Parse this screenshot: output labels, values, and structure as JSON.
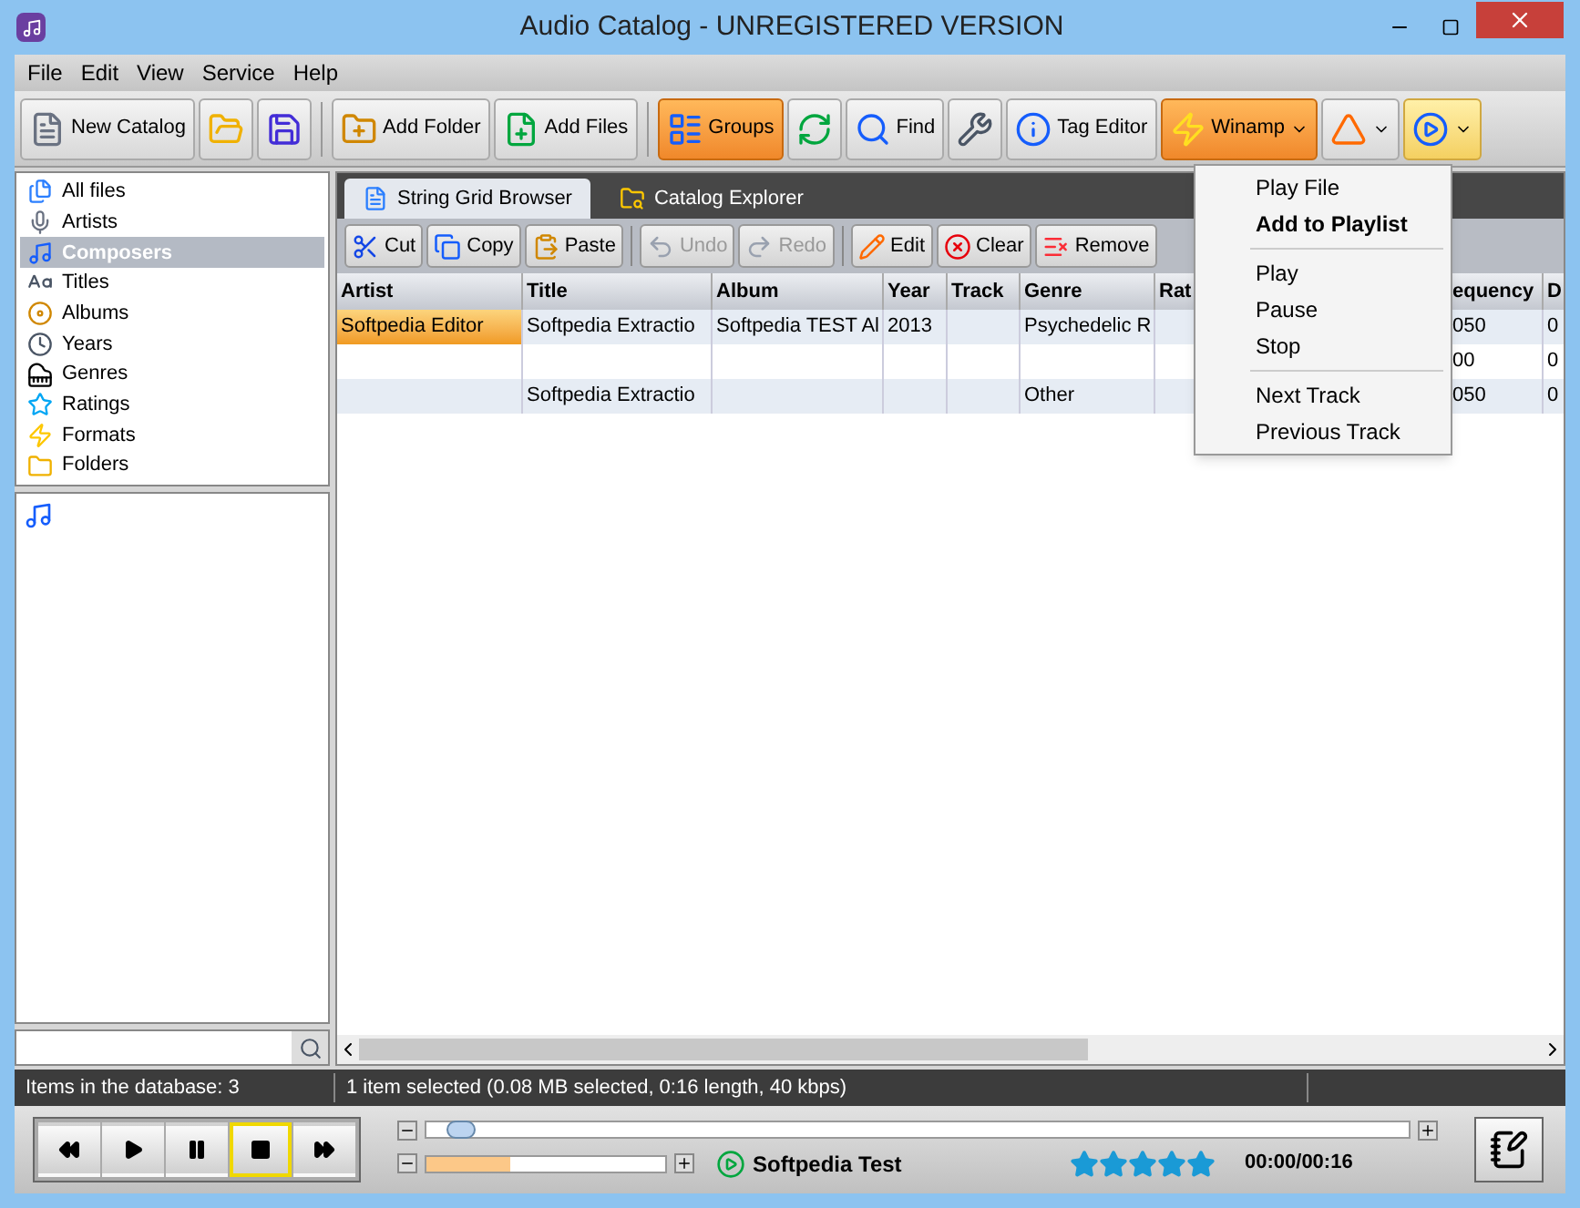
{
  "window": {
    "title": "Audio Catalog - UNREGISTERED VERSION"
  },
  "menu": [
    "File",
    "Edit",
    "View",
    "Service",
    "Help"
  ],
  "toolbar": [
    [
      {
        "label": "New Catalog",
        "selected": false
      },
      {
        "selected": false
      },
      {
        "selected": false
      }
    ],
    [
      {
        "label": "Add Folder",
        "selected": false
      },
      {
        "label": "Add Files",
        "selected": false
      }
    ],
    [
      {
        "label": "Groups",
        "selected": true
      },
      {
        "selected": false
      },
      {
        "label": "Find",
        "selected": false
      },
      {
        "selected": false
      },
      {
        "label": "Tag Editor",
        "selected": false
      },
      {
        "label": "Winamp",
        "selected": true,
        "dropdown": true
      },
      {
        "selected": false,
        "dropdown": true
      },
      {
        "selected": true,
        "dropdown": true
      }
    ]
  ],
  "sidebar": {
    "items": [
      {
        "label": "All files",
        "selected": false
      },
      {
        "label": "Artists",
        "selected": false
      },
      {
        "label": "Composers",
        "selected": true
      },
      {
        "label": "Titles",
        "selected": false
      },
      {
        "label": "Albums",
        "selected": false
      },
      {
        "label": "Years",
        "selected": false
      },
      {
        "label": "Genres",
        "selected": false
      },
      {
        "label": "Ratings",
        "selected": false
      },
      {
        "label": "Formats",
        "selected": false
      },
      {
        "label": "Folders",
        "selected": false
      }
    ]
  },
  "tabs": [
    {
      "label": "String Grid Browser",
      "selected": true
    },
    {
      "label": "Catalog Explorer",
      "selected": false
    }
  ],
  "grid_toolbar": [
    [
      {
        "label": "Cut",
        "disabled": false
      },
      {
        "label": "Copy",
        "disabled": false
      },
      {
        "label": "Paste",
        "disabled": false
      }
    ],
    [
      {
        "label": "Undo",
        "disabled": true
      },
      {
        "label": "Redo",
        "disabled": true
      }
    ],
    [
      {
        "label": "Edit",
        "disabled": false
      },
      {
        "label": "Clear",
        "disabled": false
      },
      {
        "label": "Remove",
        "disabled": false
      }
    ]
  ],
  "table": {
    "columns": [
      "Artist",
      "Title",
      "Album",
      "Year",
      "Track",
      "Genre",
      "Rat",
      "equency",
      "D"
    ],
    "rows": [
      {
        "selected": true,
        "cells": [
          {
            "text": "Softpedia Editor"
          },
          {
            "text": "Softpedia Extractio"
          },
          {
            "text": "Softpedia TEST Al"
          },
          {
            "text": "2013"
          },
          {},
          {
            "text": "Psychedelic R"
          },
          {},
          {
            "text": "050"
          },
          {
            "text": "0"
          }
        ]
      },
      {
        "selected": false,
        "cells": [
          {},
          {},
          {},
          {},
          {},
          {},
          {},
          {
            "text": "00"
          },
          {
            "text": "0"
          }
        ]
      },
      {
        "selected": false,
        "cells": [
          {},
          {
            "text": "Softpedia Extractio"
          },
          {},
          {},
          {},
          {
            "text": "Other"
          },
          {},
          {
            "text": "050"
          },
          {
            "text": "0"
          }
        ]
      }
    ]
  },
  "dropdown_menu": [
    [
      {
        "label": "Play File",
        "bold": false
      },
      {
        "label": "Add to Playlist",
        "bold": true
      }
    ],
    [
      {
        "label": "Play",
        "bold": false
      },
      {
        "label": "Pause",
        "bold": false
      },
      {
        "label": "Stop",
        "bold": false
      }
    ],
    [
      {
        "label": "Next Track",
        "bold": false
      },
      {
        "label": "Previous Track",
        "bold": false
      }
    ]
  ],
  "status_bar": {
    "left": "Items in the database: 3",
    "right": "1 item selected (0.08 MB selected, 0:16 length, 40 kbps)"
  },
  "player": {
    "buttons": [
      {
        "selected": false
      },
      {
        "selected": false
      },
      {
        "selected": false
      },
      {
        "selected": true
      },
      {
        "selected": false
      }
    ],
    "position": {
      "level": 0.02
    },
    "volume": {
      "level": 0.35
    },
    "track": "Softpedia Test",
    "stars": 5,
    "time": "00:00/00:16"
  }
}
